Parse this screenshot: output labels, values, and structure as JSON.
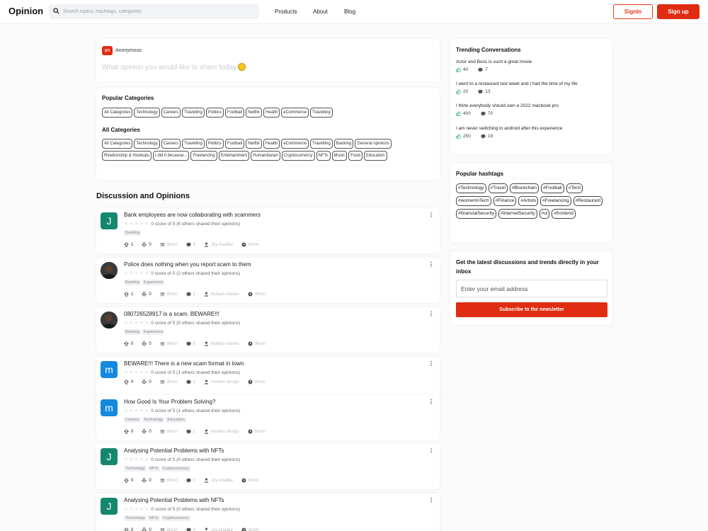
{
  "header": {
    "logo": "Opinion",
    "search_placeholder": "Search topics, hashtags, categories",
    "nav": [
      "Products",
      "About",
      "Blog"
    ],
    "signin": "SignIn",
    "signup": "Sign up"
  },
  "composer": {
    "avatar_initials": "an",
    "user": "Anonymous",
    "placeholder": "What opinion you would like to share today"
  },
  "categories": {
    "popular_title": "Popular Categories",
    "popular": [
      "All Categories",
      "Technology",
      "Careers",
      "Travelling",
      "Politics",
      "Football",
      "Netflix",
      "Health",
      "eCommerce",
      "Travelling"
    ],
    "all_title": "All Categories",
    "all": [
      "All Categories",
      "Technology",
      "Careers",
      "Travelling",
      "Politics",
      "Football",
      "Netflix",
      "Health",
      "eCommerce",
      "Travelling",
      "Banking",
      "General opinions",
      "Relationship & Hookups",
      "I did it because...",
      "Freelancing",
      "Entertainment",
      "Humanitarian",
      "Cryptocurrency",
      "NFTs",
      "Music",
      "Food",
      "Education"
    ]
  },
  "discussion_title": "Discussion and Opinions",
  "posts": [
    {
      "avatar": "J",
      "avatar_color": "#16876f",
      "title": "Bank employees are now collaborating with scammers",
      "rating": "0 score of 5 (6 others shared their opinions)",
      "tags": [
        "Banking"
      ],
      "up": "1",
      "down": "0",
      "time": "8mon",
      "comments": "6",
      "author": "Joy Analiba",
      "ago": "8mon"
    },
    {
      "avatar": "",
      "avatar_color": "#2b2b2b",
      "title": "Police does nothing when you report scam to them",
      "rating": "0 score of 5 (2 others shared their opinions)",
      "tags": [
        "Banking",
        "Experience"
      ],
      "up": "1",
      "down": "0",
      "time": "8mon",
      "comments": "2",
      "author": "ibulayo charles",
      "ago": "8mon"
    },
    {
      "avatar": "",
      "avatar_color": "#2b2b2b",
      "title": "080726528917 is a scam. BEWARE!!!",
      "rating": "0 score of 5 (5 others shared their opinions)",
      "tags": [
        "Banking",
        "Experience"
      ],
      "up": "0",
      "down": "0",
      "time": "8mon",
      "comments": "5",
      "author": "ibulayo charles",
      "ago": "8mon"
    },
    {
      "avatar": "m",
      "avatar_color": "#1389e0",
      "title": "BEWARE!!! There is a new scam format in town",
      "rating": "0 score of 5 (1 others shared their opinions)",
      "tags": [],
      "up": "0",
      "down": "0",
      "time": "8mon",
      "comments": "1",
      "author": "modern design",
      "ago": "8mon"
    },
    {
      "avatar": "m",
      "avatar_color": "#1389e0",
      "title": "How Good Is Your Problem Solving?",
      "rating": "0 score of 5 (1 others shared their opinions)",
      "tags": [
        "Careers",
        "Technology",
        "Education"
      ],
      "up": "0",
      "down": "0",
      "time": "8mon",
      "comments": "1",
      "author": "modern design",
      "ago": "8mon"
    },
    {
      "avatar": "J",
      "avatar_color": "#16876f",
      "title": "Analysing Potential Problems with NFTs",
      "rating": "0 score of 5 (0 others shared their opinions)",
      "tags": [
        "Technology",
        "NFTs",
        "Cryptocurrency"
      ],
      "up": "0",
      "down": "0",
      "time": "8mon",
      "comments": "0",
      "author": "Joy Analiba",
      "ago": "8mon"
    },
    {
      "avatar": "J",
      "avatar_color": "#16876f",
      "title": "Analysing Potential Problems with NFTs",
      "rating": "0 score of 5 (0 others shared their opinions)",
      "tags": [
        "Technology",
        "NFTs",
        "Cryptocurrency"
      ],
      "up": "0",
      "down": "0",
      "time": "8mon",
      "comments": "0",
      "author": "Joy Analiba",
      "ago": "8mon"
    }
  ],
  "trending": {
    "title": "Trending Conversations",
    "items": [
      {
        "text": "Actor and Boss is such a great movie",
        "likes": "40",
        "comments": "7"
      },
      {
        "text": "I went to a restaurant last week and I had the time of my life",
        "likes": "20",
        "comments": "13"
      },
      {
        "text": "I think everybody should own a 2022 macbook pro",
        "likes": "400",
        "comments": "70"
      },
      {
        "text": "I am never switching to android after this experience",
        "likes": "250",
        "comments": "18"
      }
    ]
  },
  "hashtags": {
    "title": "Popular hashtags",
    "items": [
      "#Technology",
      "#Travel",
      "#Blockchain",
      "#Football",
      "#Tech",
      "#womenInTech",
      "#Finance",
      "#Artists",
      "#Freelancing",
      "#Restaurant",
      "#financialSecurity",
      "#internetSecurity",
      "#ui",
      "#frontend"
    ]
  },
  "newsletter": {
    "title": "Get the latest discussions and trends directly in your inbox",
    "placeholder": "Enter your email address",
    "button": "Subscribe to the newsletter"
  },
  "colors": {
    "accent": "#e02d12",
    "like": "#1aa36f"
  }
}
